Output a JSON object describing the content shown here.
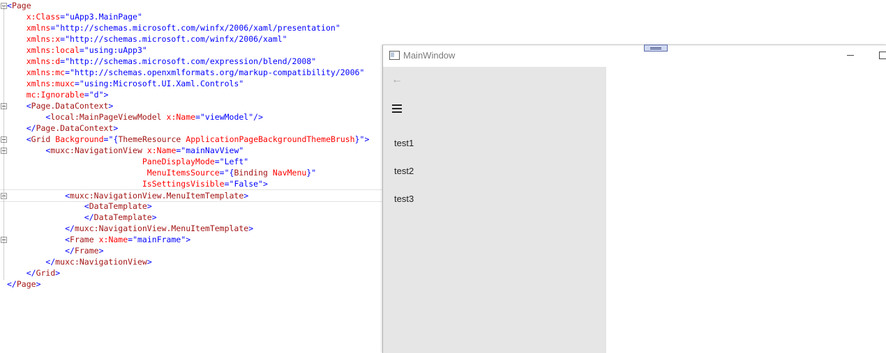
{
  "editor": {
    "lines": [
      [
        {
          "c": "b",
          "t": "<"
        },
        {
          "c": "k",
          "t": "Page"
        }
      ],
      [
        {
          "c": "",
          "t": "    "
        },
        {
          "c": "a",
          "t": "x:Class"
        },
        {
          "c": "b",
          "t": "=\""
        },
        {
          "c": "v",
          "t": "uApp3.MainPage"
        },
        {
          "c": "b",
          "t": "\""
        }
      ],
      [
        {
          "c": "",
          "t": "    "
        },
        {
          "c": "a",
          "t": "xmlns"
        },
        {
          "c": "b",
          "t": "=\""
        },
        {
          "c": "v",
          "t": "http://schemas.microsoft.com/winfx/2006/xaml/presentation"
        },
        {
          "c": "b",
          "t": "\""
        }
      ],
      [
        {
          "c": "",
          "t": "    "
        },
        {
          "c": "a",
          "t": "xmlns:x"
        },
        {
          "c": "b",
          "t": "=\""
        },
        {
          "c": "v",
          "t": "http://schemas.microsoft.com/winfx/2006/xaml"
        },
        {
          "c": "b",
          "t": "\""
        }
      ],
      [
        {
          "c": "",
          "t": "    "
        },
        {
          "c": "a",
          "t": "xmlns:local"
        },
        {
          "c": "b",
          "t": "=\""
        },
        {
          "c": "v",
          "t": "using:uApp3"
        },
        {
          "c": "b",
          "t": "\""
        }
      ],
      [
        {
          "c": "",
          "t": "    "
        },
        {
          "c": "a",
          "t": "xmlns:d"
        },
        {
          "c": "b",
          "t": "=\""
        },
        {
          "c": "v",
          "t": "http://schemas.microsoft.com/expression/blend/2008"
        },
        {
          "c": "b",
          "t": "\""
        }
      ],
      [
        {
          "c": "",
          "t": "    "
        },
        {
          "c": "a",
          "t": "xmlns:mc"
        },
        {
          "c": "b",
          "t": "=\""
        },
        {
          "c": "v",
          "t": "http://schemas.openxmlformats.org/markup-compatibility/2006"
        },
        {
          "c": "b",
          "t": "\""
        }
      ],
      [
        {
          "c": "",
          "t": "    "
        },
        {
          "c": "a",
          "t": "xmlns:muxc"
        },
        {
          "c": "b",
          "t": "=\""
        },
        {
          "c": "v",
          "t": "using:Microsoft.UI.Xaml.Controls"
        },
        {
          "c": "b",
          "t": "\""
        }
      ],
      [
        {
          "c": "",
          "t": "    "
        },
        {
          "c": "a",
          "t": "mc:Ignorable"
        },
        {
          "c": "b",
          "t": "=\""
        },
        {
          "c": "v",
          "t": "d"
        },
        {
          "c": "b",
          "t": "\">"
        }
      ],
      [
        {
          "c": "",
          "t": "    "
        },
        {
          "c": "b",
          "t": "<"
        },
        {
          "c": "k",
          "t": "Page.DataContext"
        },
        {
          "c": "b",
          "t": ">"
        }
      ],
      [
        {
          "c": "",
          "t": "        "
        },
        {
          "c": "b",
          "t": "<"
        },
        {
          "c": "k",
          "t": "local:MainPageViewModel"
        },
        {
          "c": "",
          "t": " "
        },
        {
          "c": "a",
          "t": "x:Name"
        },
        {
          "c": "b",
          "t": "=\""
        },
        {
          "c": "v",
          "t": "viewModel"
        },
        {
          "c": "b",
          "t": "\"/>"
        }
      ],
      [
        {
          "c": "",
          "t": "    "
        },
        {
          "c": "b",
          "t": "</"
        },
        {
          "c": "k",
          "t": "Page.DataContext"
        },
        {
          "c": "b",
          "t": ">"
        }
      ],
      [
        {
          "c": "",
          "t": "    "
        },
        {
          "c": "b",
          "t": "<"
        },
        {
          "c": "k",
          "t": "Grid"
        },
        {
          "c": "",
          "t": " "
        },
        {
          "c": "a",
          "t": "Background"
        },
        {
          "c": "b",
          "t": "=\""
        },
        {
          "c": "v",
          "t": "{"
        },
        {
          "c": "k",
          "t": "ThemeResource"
        },
        {
          "c": "",
          "t": " "
        },
        {
          "c": "a",
          "t": "ApplicationPageBackgroundThemeBrush"
        },
        {
          "c": "v",
          "t": "}"
        },
        {
          "c": "b",
          "t": "\">"
        }
      ],
      [
        {
          "c": "",
          "t": "        "
        },
        {
          "c": "b",
          "t": "<"
        },
        {
          "c": "k",
          "t": "muxc:NavigationView"
        },
        {
          "c": "",
          "t": " "
        },
        {
          "c": "a",
          "t": "x:Name"
        },
        {
          "c": "b",
          "t": "=\""
        },
        {
          "c": "v",
          "t": "mainNavView"
        },
        {
          "c": "b",
          "t": "\""
        }
      ],
      [
        {
          "c": "",
          "t": "                            "
        },
        {
          "c": "a",
          "t": "PaneDisplayMode"
        },
        {
          "c": "b",
          "t": "=\""
        },
        {
          "c": "v",
          "t": "Left"
        },
        {
          "c": "b",
          "t": "\""
        }
      ],
      [
        {
          "c": "",
          "t": "                             "
        },
        {
          "c": "a",
          "t": "MenuItemsSource"
        },
        {
          "c": "b",
          "t": "=\""
        },
        {
          "c": "v",
          "t": "{"
        },
        {
          "c": "k",
          "t": "Binding"
        },
        {
          "c": "",
          "t": " "
        },
        {
          "c": "a",
          "t": "NavMenu"
        },
        {
          "c": "v",
          "t": "}"
        },
        {
          "c": "b",
          "t": "\""
        }
      ],
      [
        {
          "c": "",
          "t": "                            "
        },
        {
          "c": "a",
          "t": "IsSettingsVisible"
        },
        {
          "c": "b",
          "t": "=\""
        },
        {
          "c": "v",
          "t": "False"
        },
        {
          "c": "b",
          "t": "\">"
        }
      ],
      [
        {
          "c": "",
          "t": "            "
        },
        {
          "c": "b",
          "t": "<"
        },
        {
          "c": "k",
          "t": "muxc:NavigationView.MenuItemTemplate"
        },
        {
          "c": "b",
          "t": ">"
        }
      ],
      [
        {
          "c": "",
          "t": "                "
        },
        {
          "c": "b",
          "t": "<"
        },
        {
          "c": "k",
          "t": "DataTemplate"
        },
        {
          "c": "b",
          "t": ">"
        }
      ],
      [
        {
          "c": "",
          "t": "                "
        },
        {
          "c": "b",
          "t": "</"
        },
        {
          "c": "k",
          "t": "DataTemplate"
        },
        {
          "c": "b",
          "t": ">"
        }
      ],
      [
        {
          "c": "",
          "t": "            "
        },
        {
          "c": "b",
          "t": "</"
        },
        {
          "c": "k",
          "t": "muxc:NavigationView.MenuItemTemplate"
        },
        {
          "c": "b",
          "t": ">"
        }
      ],
      [
        {
          "c": "",
          "t": "            "
        },
        {
          "c": "b",
          "t": "<"
        },
        {
          "c": "k",
          "t": "Frame"
        },
        {
          "c": "",
          "t": " "
        },
        {
          "c": "a",
          "t": "x:Name"
        },
        {
          "c": "b",
          "t": "=\""
        },
        {
          "c": "v",
          "t": "mainFrame"
        },
        {
          "c": "b",
          "t": "\">"
        }
      ],
      [
        {
          "c": "",
          "t": "            "
        },
        {
          "c": "b",
          "t": "</"
        },
        {
          "c": "k",
          "t": "Frame"
        },
        {
          "c": "b",
          "t": ">"
        }
      ],
      [
        {
          "c": "",
          "t": "        "
        },
        {
          "c": "b",
          "t": "</"
        },
        {
          "c": "k",
          "t": "muxc:NavigationView"
        },
        {
          "c": "b",
          "t": ">"
        }
      ],
      [
        {
          "c": "",
          "t": "    "
        },
        {
          "c": "b",
          "t": "</"
        },
        {
          "c": "k",
          "t": "Grid"
        },
        {
          "c": "b",
          "t": ">"
        }
      ],
      [
        {
          "c": "b",
          "t": "</"
        },
        {
          "c": "k",
          "t": "Page"
        },
        {
          "c": "b",
          "t": ">"
        }
      ]
    ]
  },
  "window": {
    "title": "MainWindow",
    "back_icon": "←",
    "menu_items": [
      {
        "label": "test1"
      },
      {
        "label": "test2"
      },
      {
        "label": "test3"
      }
    ]
  },
  "colors": {
    "tag": "#a31515",
    "attribute": "#ff0000",
    "value": "#0000ff",
    "pane_background": "#e6e6e6"
  }
}
